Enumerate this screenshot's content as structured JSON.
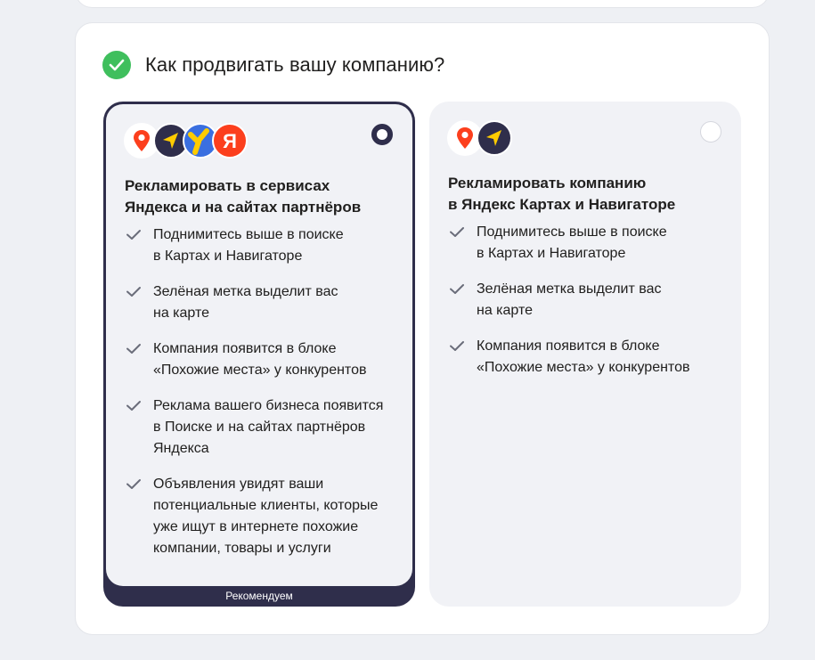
{
  "page": {
    "title": "Как продвигать вашу компанию?"
  },
  "colors": {
    "accent_dark": "#2f2e4b",
    "success_green": "#3fbf5d",
    "card_bg": "#f1f2f6"
  },
  "options": [
    {
      "title": "Рекламировать в сервисах\nЯндекса и на сайтах партнёров",
      "selected": true,
      "badge": "Рекомендуем",
      "icons": [
        "yandex-maps-icon",
        "yandex-navigator-icon",
        "yandex-direct-icon",
        "yandex-icon"
      ],
      "features": [
        "Поднимитесь выше в поиске\nв Картах и Навигаторе",
        "Зелёная метка выделит вас\nна карте",
        "Компания появится в блоке\n«Похожие места» у конкурентов",
        "Реклама вашего бизнеса появится\nв Поиске и на сайтах партнёров\nЯндекса",
        "Объявления увидят ваши\nпотенциальные клиенты, которые\nуже ищут в интернете похожие\nкомпании, товары и услуги"
      ]
    },
    {
      "title": "Рекламировать компанию\nв Яндекс Картах и Навигаторе",
      "selected": false,
      "icons": [
        "yandex-maps-icon",
        "yandex-navigator-icon"
      ],
      "features": [
        "Поднимитесь выше в поиске\nв Картах и Навигаторе",
        "Зелёная метка выделит вас\nна карте",
        "Компания появится в блоке\n«Похожие места» у конкурентов"
      ]
    }
  ]
}
